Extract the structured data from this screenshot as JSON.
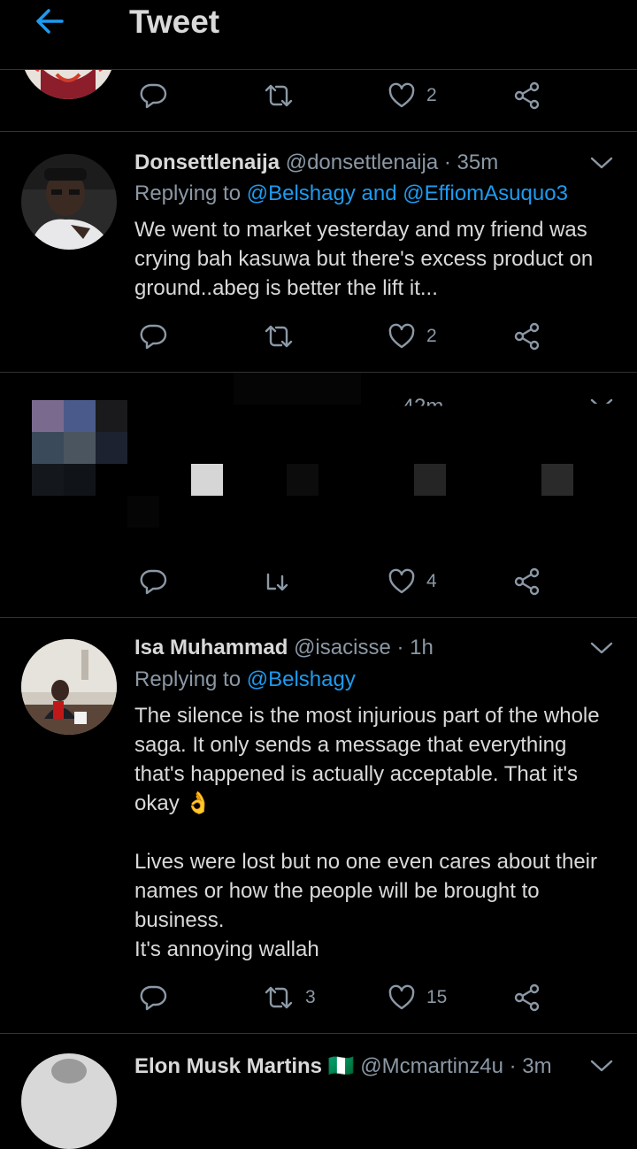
{
  "header": {
    "title": "Tweet",
    "back_icon": "arrow-left-icon"
  },
  "colors": {
    "accent": "#1d9bf0",
    "muted": "#8b98a5",
    "text": "#d9d9d9",
    "background": "#000000",
    "divider": "#2f3336"
  },
  "top_tweet": {
    "actions": {
      "reply_icon": "reply-icon",
      "retweet_icon": "retweet-icon",
      "like_icon": "heart-icon",
      "like_count": "2",
      "share_icon": "share-icon"
    }
  },
  "tweets": [
    {
      "name": "Donsettlenaija",
      "meta": "@donsettlenaija · 35m",
      "replying_prefix": "Replying to ",
      "replying_to": "@Belshagy and @EffiomAsuquo3",
      "text": "We went to market yesterday and my friend was crying bah kasuwa but there's excess product on ground..abeg is better the lift it...",
      "retweet_count": "",
      "like_count": "2"
    },
    {
      "name": "",
      "meta": "· 42m",
      "redacted": true,
      "retweet_count": "",
      "like_count": "4"
    },
    {
      "name": "Isa Muhammad",
      "meta": "@isacisse · 1h",
      "replying_prefix": "Replying to ",
      "replying_to": "@Belshagy",
      "text_paragraphs": [
        "The silence is the most injurious part of the whole saga. It only sends a message that everything that's happened is actually acceptable. That it's okay 👌",
        "Lives were lost but no one even cares about their names or how the people will be brought to business.\nIt's annoying wallah"
      ],
      "retweet_count": "3",
      "like_count": "15"
    },
    {
      "name": "Elon Musk Martins 🇳🇬",
      "meta": "@Mcmartinz4u · 3m"
    }
  ]
}
